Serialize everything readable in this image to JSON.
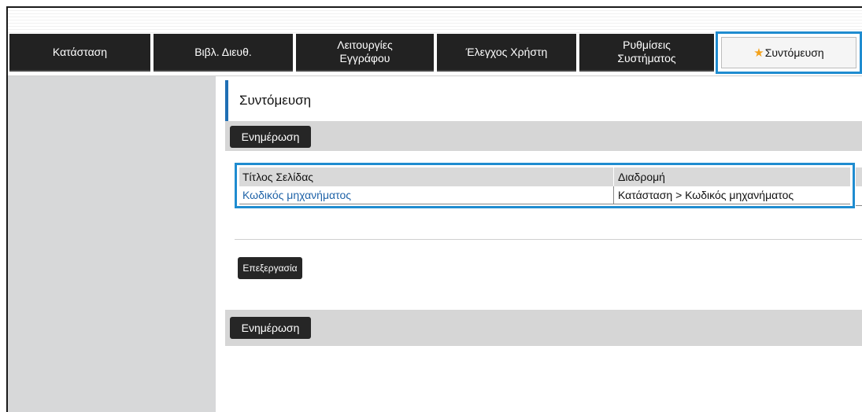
{
  "tabs": [
    {
      "label": "Κατάσταση"
    },
    {
      "label": "Βιβλ. Διευθ."
    },
    {
      "label": "Λειτουργίες\nΕγγράφου"
    },
    {
      "label": "Έλεγχος Χρήστη"
    },
    {
      "label": "Ρυθμίσεις\nΣυστήματος"
    },
    {
      "label": "Συντόμευση",
      "icon": "star-icon",
      "active": true
    }
  ],
  "page": {
    "title": "Συντόμευση",
    "update_button_top": "Ενημέρωση",
    "update_button_bottom": "Ενημέρωση",
    "edit_button": "Επεξεργασία"
  },
  "table": {
    "headers": [
      "Τίτλος Σελίδας",
      "Διαδρομή"
    ],
    "rows": [
      {
        "title": "Κωδικός μηχανήματος",
        "path": "Κατάσταση >  Κωδικός μηχανήματος"
      }
    ]
  },
  "colors": {
    "accent": "#1f8cd0",
    "tab_bg": "#222222",
    "link": "#1f63a8",
    "star": "#f3a21b"
  }
}
